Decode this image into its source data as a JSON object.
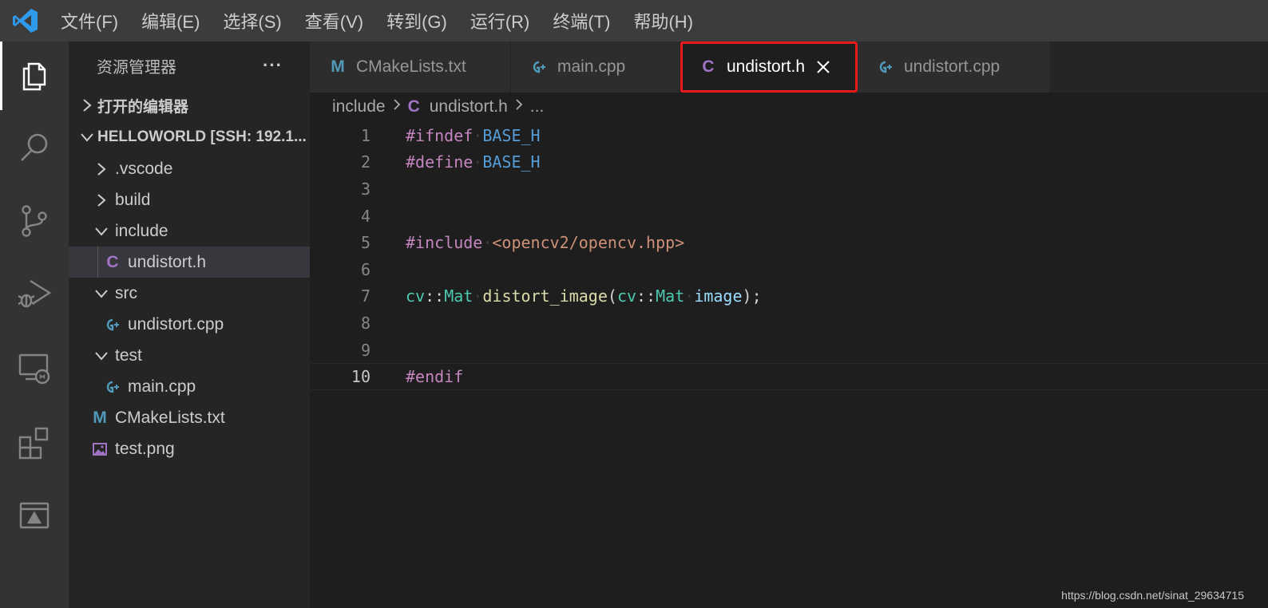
{
  "menu": [
    "文件(F)",
    "编辑(E)",
    "选择(S)",
    "查看(V)",
    "转到(G)",
    "运行(R)",
    "终端(T)",
    "帮助(H)"
  ],
  "activity_bar": [
    "files-icon",
    "search-icon",
    "source-control-icon",
    "run-debug-icon",
    "remote-explorer-icon",
    "extensions-icon",
    "remote-panel-icon"
  ],
  "sidebar": {
    "title": "资源管理器",
    "more": "···",
    "open_editors": "打开的编辑器",
    "workspace": "HELLOWORLD [SSH: 192.1...",
    "tree": [
      {
        "label": ".vscode",
        "type": "folder",
        "expanded": false,
        "depth": 0
      },
      {
        "label": "build",
        "type": "folder",
        "expanded": false,
        "depth": 0
      },
      {
        "label": "include",
        "type": "folder",
        "expanded": true,
        "depth": 0
      },
      {
        "label": "undistort.h",
        "type": "c-header",
        "icon": "C",
        "depth": 1,
        "selected": true
      },
      {
        "label": "src",
        "type": "folder",
        "expanded": true,
        "depth": 0
      },
      {
        "label": "undistort.cpp",
        "type": "cpp",
        "icon": "G+",
        "depth": 1
      },
      {
        "label": "test",
        "type": "folder",
        "expanded": true,
        "depth": 0
      },
      {
        "label": "main.cpp",
        "type": "cpp",
        "icon": "G+",
        "depth": 1
      },
      {
        "label": "CMakeLists.txt",
        "type": "cmake",
        "icon": "M",
        "depth": 0
      },
      {
        "label": "test.png",
        "type": "image",
        "icon": "image-icon",
        "depth": 0
      }
    ]
  },
  "tabs": [
    {
      "label": "CMakeLists.txt",
      "icon": "M",
      "active": false
    },
    {
      "label": "main.cpp",
      "icon": "G+",
      "active": false
    },
    {
      "label": "undistort.h",
      "icon": "C",
      "active": true,
      "close": "×"
    },
    {
      "label": "undistort.cpp",
      "icon": "G+",
      "active": false
    }
  ],
  "breadcrumb": {
    "folder": "include",
    "file": "undistort.h",
    "ellipsis": "..."
  },
  "code_lines": [
    {
      "n": "1",
      "tokens": [
        [
          "kw",
          "#ifndef"
        ],
        [
          "ws",
          "·"
        ],
        [
          "mac",
          "BASE_H"
        ]
      ]
    },
    {
      "n": "2",
      "tokens": [
        [
          "kw",
          "#define"
        ],
        [
          "ws",
          "·"
        ],
        [
          "mac",
          "BASE_H"
        ]
      ]
    },
    {
      "n": "3",
      "tokens": []
    },
    {
      "n": "4",
      "tokens": []
    },
    {
      "n": "5",
      "tokens": [
        [
          "kw",
          "#include"
        ],
        [
          "ws",
          "·"
        ],
        [
          "str",
          "<opencv2/opencv.hpp>"
        ]
      ]
    },
    {
      "n": "6",
      "tokens": []
    },
    {
      "n": "7",
      "tokens": [
        [
          "ty",
          "cv"
        ],
        [
          "plain",
          "::"
        ],
        [
          "ty",
          "Mat"
        ],
        [
          "ws",
          "·"
        ],
        [
          "fn",
          "distort_image"
        ],
        [
          "plain",
          "("
        ],
        [
          "ty",
          "cv"
        ],
        [
          "plain",
          "::"
        ],
        [
          "ty",
          "Mat"
        ],
        [
          "ws",
          "·"
        ],
        [
          "var",
          "image"
        ],
        [
          "plain",
          ");"
        ]
      ]
    },
    {
      "n": "8",
      "tokens": []
    },
    {
      "n": "9",
      "tokens": []
    },
    {
      "n": "10",
      "tokens": [
        [
          "kw",
          "#endif"
        ]
      ],
      "current": true
    }
  ],
  "watermark": "https://blog.csdn.net/sinat_29634715",
  "colors": {
    "accent_red": "#e51b1b",
    "c_icon": "#a074c4",
    "cpp_icon": "#519aba",
    "cmake_icon": "#519aba"
  }
}
